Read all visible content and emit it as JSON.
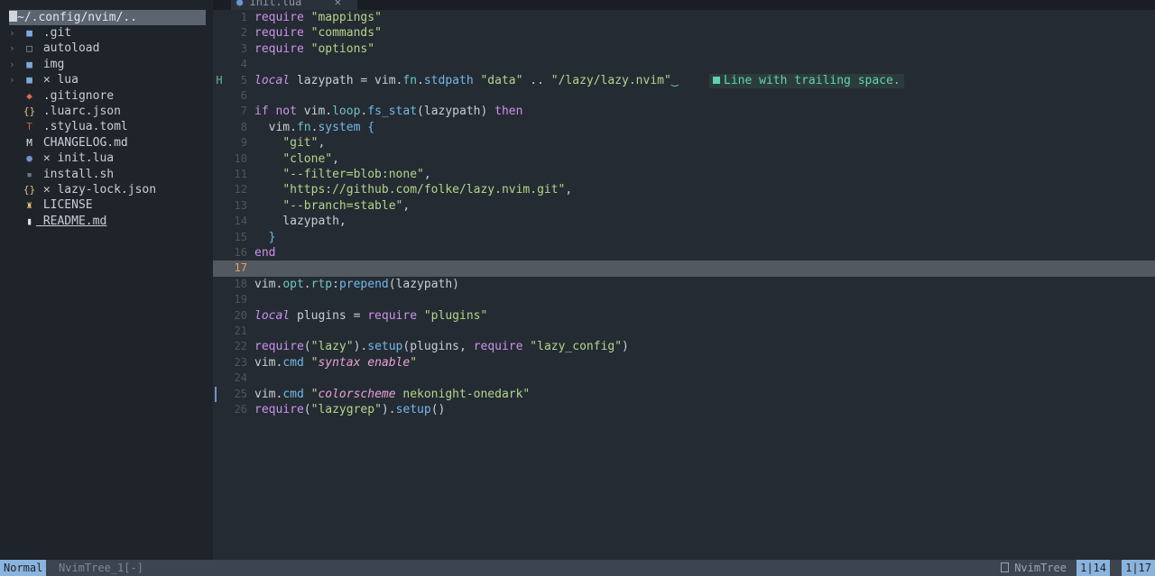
{
  "sidebar": {
    "root": "~/.config/nvim/..",
    "items": [
      {
        "chev": "›",
        "icon": "folder-icon",
        "label": ".git",
        "cls": "dir"
      },
      {
        "chev": "›",
        "icon": "folder-open-icon",
        "label": "autoload",
        "cls": "dir"
      },
      {
        "chev": "›",
        "icon": "folder-icon",
        "label": "img",
        "cls": "dir"
      },
      {
        "chev": "›",
        "icon": "folder-icon",
        "label": "✕ lua",
        "cls": "dir"
      },
      {
        "chev": "",
        "icon": "git-icon",
        "label": ".gitignore",
        "cls": "file"
      },
      {
        "chev": "",
        "icon": "json-icon",
        "label": ".luarc.json",
        "cls": "file"
      },
      {
        "chev": "",
        "icon": "toml-icon",
        "label": ".stylua.toml",
        "cls": "file"
      },
      {
        "chev": "",
        "icon": "markdown-icon",
        "label": "CHANGELOG.md",
        "cls": "file"
      },
      {
        "chev": "",
        "icon": "lua-icon",
        "label": "✕ init.lua",
        "cls": "file"
      },
      {
        "chev": "",
        "icon": "shell-icon",
        "label": "install.sh",
        "cls": "file"
      },
      {
        "chev": "",
        "icon": "json-icon",
        "label": "✕ lazy-lock.json",
        "cls": "file"
      },
      {
        "chev": "",
        "icon": "license-icon",
        "label": "LICENSE",
        "cls": "file"
      },
      {
        "chev": "",
        "icon": "readme-icon",
        "label": "README.md",
        "cls": "readme"
      }
    ]
  },
  "tab": {
    "label": "init.lua",
    "close": "✕"
  },
  "editor": {
    "lines": [
      {
        "n": "1",
        "html": "<span class='kw'>require</span> <span class='str'>\"mappings\"</span>"
      },
      {
        "n": "2",
        "html": "<span class='kw'>require</span> <span class='str'>\"commands\"</span>"
      },
      {
        "n": "3",
        "html": "<span class='kw'>require</span> <span class='str'>\"options\"</span>"
      },
      {
        "n": "4",
        "html": ""
      },
      {
        "n": "5",
        "sign": "H",
        "html": "<span class='kwi'>local</span> lazypath = vim.<span class='field'>fn</span>.<span class='fn'>stdpath</span> <span class='str'>\"data\"</span> .. <span class='str'>\"/lazy/lazy.nvim\"</span><span class='trail'>‿</span>",
        "diag": "Line with trailing space."
      },
      {
        "n": "6",
        "html": ""
      },
      {
        "n": "7",
        "html": "<span class='kw'>if not</span> vim.<span class='field'>loop</span>.<span class='fn'>fs_stat</span>(lazypath) <span class='kw'>then</span>"
      },
      {
        "n": "8",
        "html": "  vim.<span class='field'>fn</span>.<span class='fn'>system</span> <span class='fn'>{</span>"
      },
      {
        "n": "9",
        "html": "    <span class='str'>\"git\"</span>,"
      },
      {
        "n": "10",
        "html": "    <span class='str'>\"clone\"</span>,"
      },
      {
        "n": "11",
        "html": "    <span class='str'>\"--filter=blob:none\"</span>,"
      },
      {
        "n": "12",
        "html": "    <span class='str'>\"https://github.com/folke/lazy.nvim.git\"</span>,"
      },
      {
        "n": "13",
        "html": "    <span class='str'>\"--branch=stable\"</span>,"
      },
      {
        "n": "14",
        "html": "    lazypath,"
      },
      {
        "n": "15",
        "html": "  <span class='fn'>}</span>"
      },
      {
        "n": "16",
        "html": "<span class='kw'>end</span>"
      },
      {
        "n": "17",
        "cursor": true,
        "html": ""
      },
      {
        "n": "18",
        "html": "vim.<span class='field'>opt</span>.<span class='field'>rtp</span>:<span class='fn'>prepend</span>(lazypath)"
      },
      {
        "n": "19",
        "html": ""
      },
      {
        "n": "20",
        "html": "<span class='kwi'>local</span> plugins = <span class='kw'>require</span> <span class='str'>\"plugins\"</span>"
      },
      {
        "n": "21",
        "html": ""
      },
      {
        "n": "22",
        "html": "<span class='kw'>require</span>(<span class='str'>\"lazy\"</span>).<span class='fn'>setup</span>(plugins, <span class='kw'>require</span> <span class='str'>\"lazy_config\"</span>)"
      },
      {
        "n": "23",
        "html": "vim.<span class='fn'>cmd</span> <span class='str'>\"</span><span class='strit'>syntax enable</span><span class='str'>\"</span>"
      },
      {
        "n": "24",
        "html": ""
      },
      {
        "n": "25",
        "bar": true,
        "html": "vim.<span class='fn'>cmd</span> <span class='str'>\"</span><span class='strit'>colorscheme</span><span class='str'> nekonight-onedark\"</span>"
      },
      {
        "n": "26",
        "html": "<span class='kw'>require</span>(<span class='str'>\"lazygrep\"</span>).<span class='fn'>setup</span>()"
      }
    ]
  },
  "statusline": {
    "mode": "Normal",
    "buffer": "NvimTree_1[-]",
    "filetype": "NvimTree",
    "position": "1|14",
    "position2": "1|17"
  },
  "colors": {
    "accent": "#8ab3dd",
    "cursorline": "#535960",
    "sidebar_bg": "#1f242b",
    "editor_bg": "#252b33"
  }
}
